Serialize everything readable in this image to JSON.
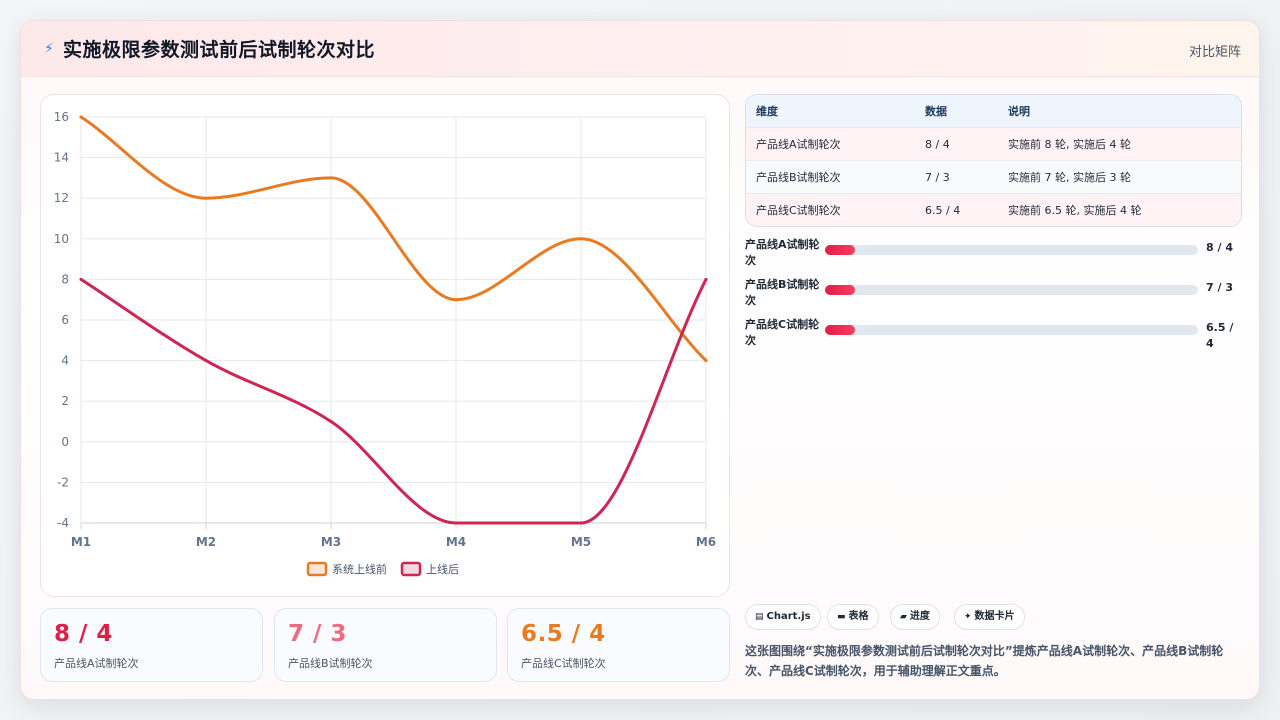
{
  "header": {
    "icon": "lightning-icon",
    "title": "实施极限参数测试前后试制轮次对比",
    "tag": "对比矩阵"
  },
  "chart_data": {
    "type": "line",
    "categories": [
      "M1",
      "M2",
      "M3",
      "M4",
      "M5",
      "M6"
    ],
    "series": [
      {
        "name": "系统上线前",
        "values": [
          16,
          12,
          13,
          7,
          10,
          4
        ],
        "color": "#ea7a1f"
      },
      {
        "name": "上线后",
        "values": [
          8,
          4,
          1,
          -4,
          -4,
          8
        ],
        "color": "#cf2552"
      }
    ],
    "ylim": [
      -4,
      16
    ],
    "yticks": [
      "16",
      "14",
      "12",
      "10",
      "8",
      "6",
      "4",
      "2",
      "0",
      "-2",
      "-4"
    ],
    "grid": true,
    "legend": "bottom"
  },
  "stats": [
    {
      "value": "8 / 4",
      "label": "产品线A试制轮次",
      "color": "#e11d48"
    },
    {
      "value": "7 / 3",
      "label": "产品线B试制轮次",
      "color": "#f06a7f"
    },
    {
      "value": "6.5 / 4",
      "label": "产品线C试制轮次",
      "color": "#ea7a1f"
    }
  ],
  "table": {
    "headers": [
      "维度",
      "数据",
      "说明"
    ],
    "rows": [
      [
        "产品线A试制轮次",
        "8 / 4",
        "实施前 8 轮, 实施后 4 轮"
      ],
      [
        "产品线B试制轮次",
        "7 / 3",
        "实施前 7 轮, 实施后 3 轮"
      ],
      [
        "产品线C试制轮次",
        "6.5 / 4",
        "实施前 6.5 轮, 实施后 4 轮"
      ]
    ]
  },
  "progress": [
    {
      "label": "产品线A试制轮次",
      "value": "8 / 4",
      "fill": 0.08
    },
    {
      "label": "产品线B试制轮次",
      "value": "7 / 3",
      "fill": 0.08
    },
    {
      "label": "产品线C试制轮次",
      "value": "6.5 / 4",
      "fill": 0.08
    }
  ],
  "chips": [
    {
      "icon": "chart-icon",
      "label": "Chart.js"
    },
    {
      "icon": "table-icon",
      "label": "表格"
    },
    {
      "icon": "progress-icon",
      "label": "进度"
    },
    {
      "icon": "sparkle-icon",
      "label": "数据卡片"
    }
  ],
  "description": "这张图围绕“实施极限参数测试前后试制轮次对比”提炼产品线A试制轮次、产品线B试制轮次、产品线C试制轮次，用于辅助理解正文重点。"
}
